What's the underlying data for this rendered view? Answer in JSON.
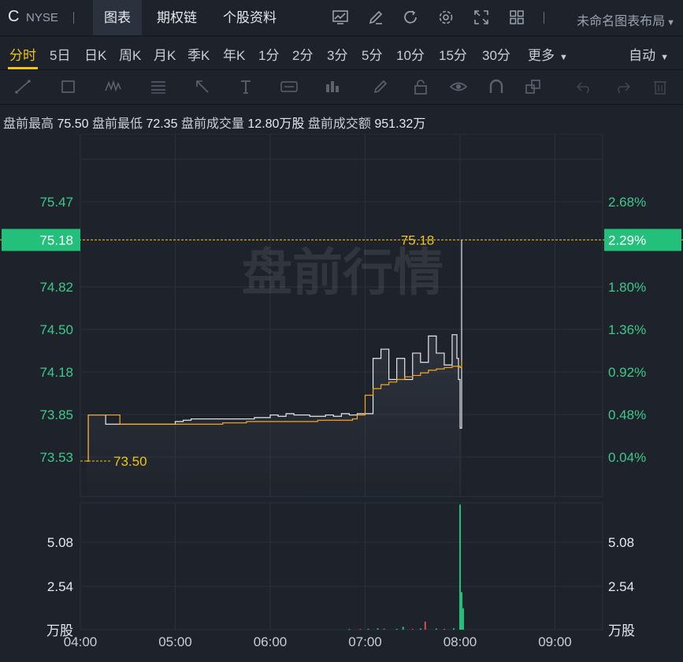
{
  "header": {
    "symbol": "C",
    "exchange": "NYSE",
    "tabs": [
      "图表",
      "期权链",
      "个股资料"
    ],
    "layout_name": "未命名图表布局"
  },
  "periods": [
    "分时",
    "5日",
    "日K",
    "周K",
    "月K",
    "季K",
    "年K",
    "1分",
    "2分",
    "3分",
    "5分",
    "10分",
    "15分",
    "30分",
    "更多"
  ],
  "auto_label": "自动",
  "stats": {
    "high_label": "盘前最高",
    "high": "75.50",
    "low_label": "盘前最低",
    "low": "72.35",
    "vol_label": "盘前成交量",
    "vol": "12.80万股",
    "amt_label": "盘前成交额",
    "amt": "951.32万"
  },
  "chart_data": {
    "type": "line",
    "watermark": "盘前行情",
    "x_ticks": [
      "04:00",
      "05:00",
      "06:00",
      "07:00",
      "08:00",
      "09:00"
    ],
    "y_price_ticks": [
      "75.47",
      "74.82",
      "74.50",
      "74.18",
      "73.85",
      "73.53"
    ],
    "y_pct_ticks": [
      "2.68%",
      "1.80%",
      "1.36%",
      "0.92%",
      "0.48%",
      "0.04%"
    ],
    "ylim": [
      73.3,
      75.8
    ],
    "prev_close": 73.5,
    "prev_close_label": "73.50",
    "current_price": 75.18,
    "current_price_label": "75.18",
    "current_pct_label": "2.29%",
    "price_series": {
      "name": "price",
      "x": [
        "04:04",
        "04:05",
        "04:15",
        "04:16",
        "04:25",
        "04:35",
        "04:45",
        "04:55",
        "05:00",
        "05:05",
        "05:10",
        "05:15",
        "05:20",
        "05:30",
        "05:40",
        "05:50",
        "06:00",
        "06:05",
        "06:10",
        "06:15",
        "06:20",
        "06:25",
        "06:30",
        "06:35",
        "06:40",
        "06:45",
        "06:50",
        "06:55",
        "07:05",
        "07:10",
        "07:15",
        "07:20",
        "07:25",
        "07:30",
        "07:35",
        "07:40",
        "07:45",
        "07:50",
        "07:55",
        "07:58",
        "07:59",
        "08:00",
        "08:01"
      ],
      "values": [
        73.5,
        73.85,
        73.85,
        73.78,
        73.78,
        73.78,
        73.78,
        73.78,
        73.8,
        73.81,
        73.82,
        73.82,
        73.82,
        73.82,
        73.82,
        73.83,
        73.85,
        73.84,
        73.86,
        73.85,
        73.85,
        73.84,
        73.84,
        73.85,
        73.84,
        73.86,
        73.85,
        73.86,
        74.28,
        74.35,
        74.12,
        74.28,
        74.12,
        74.32,
        74.25,
        74.45,
        74.32,
        74.23,
        74.46,
        74.28,
        74.12,
        73.75,
        75.18
      ]
    },
    "avg_series": {
      "name": "avg",
      "x": [
        "04:04",
        "04:05",
        "04:24",
        "04:25",
        "04:55",
        "05:00",
        "05:30",
        "05:45",
        "06:00",
        "06:30",
        "06:50",
        "06:52",
        "06:55",
        "07:00",
        "07:05",
        "07:10",
        "07:15",
        "07:20",
        "07:25",
        "07:30",
        "07:35",
        "07:40",
        "07:45",
        "07:50",
        "07:55",
        "07:58",
        "07:59",
        "08:00",
        "08:01"
      ],
      "values": [
        73.5,
        73.85,
        73.85,
        73.78,
        73.78,
        73.78,
        73.79,
        73.8,
        73.8,
        73.81,
        73.81,
        73.82,
        73.85,
        74.0,
        74.05,
        74.08,
        74.1,
        74.12,
        74.14,
        74.15,
        74.17,
        74.19,
        74.2,
        74.21,
        74.22,
        74.22,
        74.22,
        74.21,
        74.26
      ]
    },
    "volume": {
      "ticks": [
        "5.08",
        "2.54"
      ],
      "unit": "万股",
      "ylim": [
        0,
        7.1
      ],
      "bars": [
        {
          "x": "06:50",
          "v": 0.03,
          "dir": "up"
        },
        {
          "x": "06:57",
          "v": 0.04,
          "dir": "down"
        },
        {
          "x": "07:02",
          "v": 0.05,
          "dir": "up"
        },
        {
          "x": "07:08",
          "v": 0.08,
          "dir": "up"
        },
        {
          "x": "07:12",
          "v": 0.06,
          "dir": "down"
        },
        {
          "x": "07:20",
          "v": 0.05,
          "dir": "up"
        },
        {
          "x": "07:24",
          "v": 0.16,
          "dir": "up"
        },
        {
          "x": "07:30",
          "v": 0.05,
          "dir": "down"
        },
        {
          "x": "07:35",
          "v": 0.07,
          "dir": "up"
        },
        {
          "x": "07:38",
          "v": 0.45,
          "dir": "down"
        },
        {
          "x": "07:45",
          "v": 0.06,
          "dir": "up"
        },
        {
          "x": "07:50",
          "v": 0.05,
          "dir": "down"
        },
        {
          "x": "07:56",
          "v": 0.08,
          "dir": "up"
        },
        {
          "x": "08:00",
          "v": 7.0,
          "dir": "up"
        },
        {
          "x": "08:01",
          "v": 2.1,
          "dir": "up"
        },
        {
          "x": "08:02",
          "v": 1.2,
          "dir": "up"
        }
      ]
    },
    "colors": {
      "up": "#23c07b",
      "down": "#e04b4b",
      "price_line": "#e8e8e8",
      "avg_line": "#f5a623",
      "accent": "#f0c419",
      "label_green": "#3ec98a"
    }
  }
}
